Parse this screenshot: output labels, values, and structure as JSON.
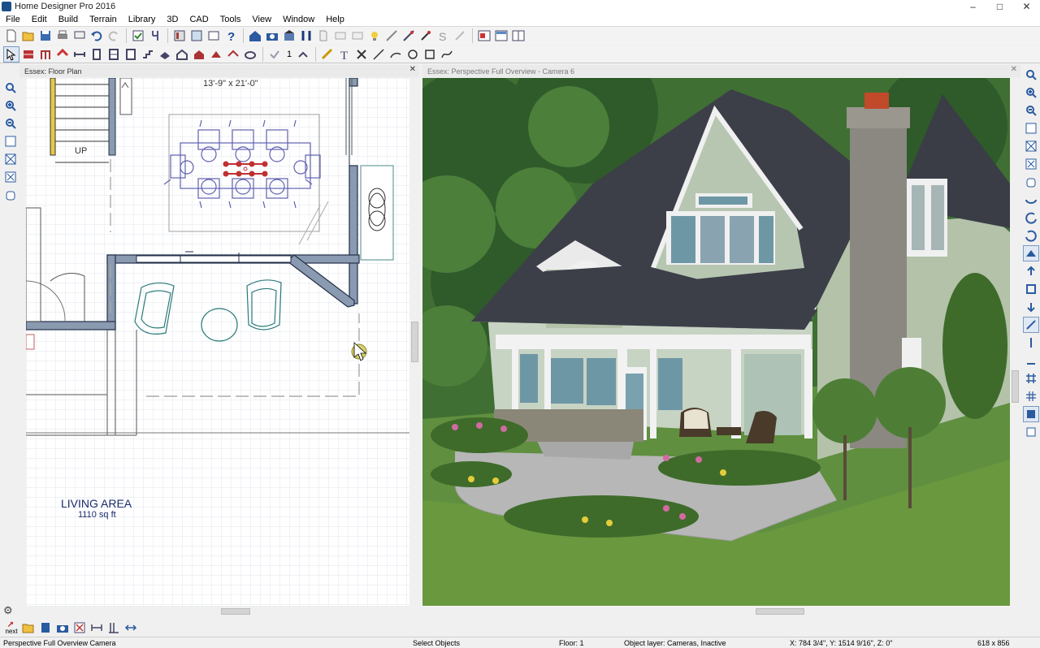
{
  "app": {
    "title": "Home Designer Pro 2016"
  },
  "window_controls": [
    "–",
    "□",
    "✕"
  ],
  "menu": [
    "File",
    "Edit",
    "Build",
    "Terrain",
    "Library",
    "3D",
    "CAD",
    "Tools",
    "View",
    "Window",
    "Help"
  ],
  "toolbar2": {
    "number_label": "1"
  },
  "floor_pane": {
    "title": "Essex: Floor Plan",
    "dimension_label": "13'-9\" x 21'-0\"",
    "stair_label": "UP",
    "room_name": "LIVING AREA",
    "room_area": "1110 sq ft"
  },
  "perspective_pane": {
    "title": "Essex: Perspective Full Overview - Camera 6"
  },
  "bottom_toolbar": {
    "next_label": "next"
  },
  "status": {
    "camera": "Perspective Full Overview Camera",
    "mode": "Select Objects",
    "floor": "Floor: 1",
    "layer": "Object layer: Cameras, Inactive",
    "coords": "X: 784 3/4\", Y: 1514 9/16\", Z: 0\"",
    "size": "618 x 856"
  },
  "colors": {
    "wall_fill": "#8a9ab0",
    "wall_outline": "#23304a",
    "furniture": "#4a8a8a",
    "chairs": "#6060b0",
    "siding": "#b8c6b0",
    "roof": "#3c3f48",
    "lawn": "#5a8a3a"
  }
}
